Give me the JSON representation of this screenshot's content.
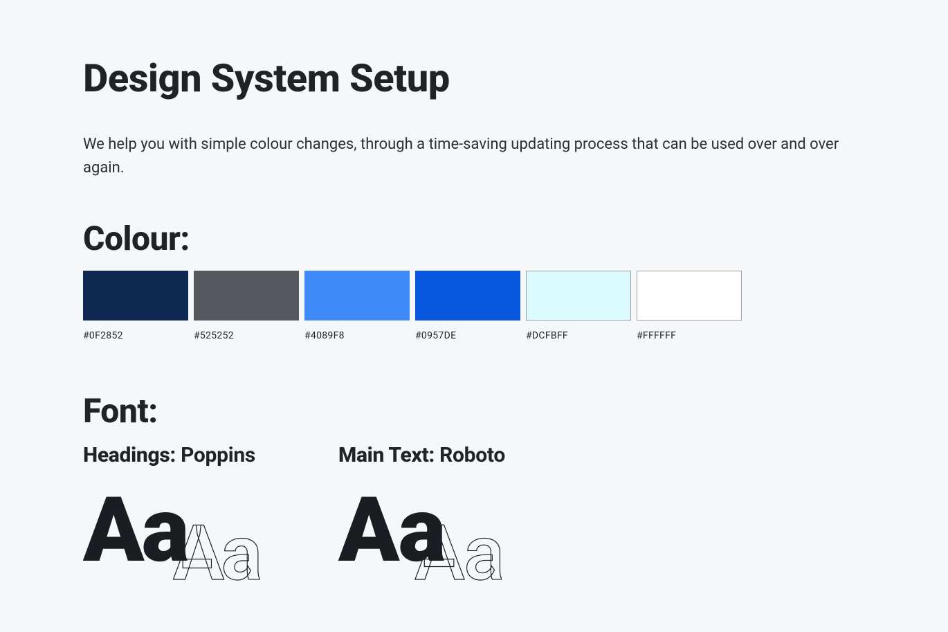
{
  "title": "Design System Setup",
  "intro": "We help you with simple colour changes, through a time-saving updating process that can be used over and over again.",
  "sections": {
    "colour": {
      "heading": "Colour:",
      "swatches": [
        {
          "hex": "#0F2852",
          "fill": "#0f2852",
          "outlined": false
        },
        {
          "hex": "#525252",
          "fill": "#54575b",
          "outlined": false
        },
        {
          "hex": "#4089F8",
          "fill": "#4089f8",
          "outlined": false
        },
        {
          "hex": "#0957DE",
          "fill": "#0957de",
          "outlined": false
        },
        {
          "hex": "#DCFBFF",
          "fill": "#dcfbff",
          "outlined": true
        },
        {
          "hex": "#FFFFFF",
          "fill": "#ffffff",
          "outlined": true
        }
      ]
    },
    "font": {
      "heading": "Font:",
      "headings_label": "Headings:",
      "headings_name": "Poppins",
      "maintext_label": "Main Text:",
      "maintext_name": "Roboto",
      "sample": "Aa"
    }
  }
}
